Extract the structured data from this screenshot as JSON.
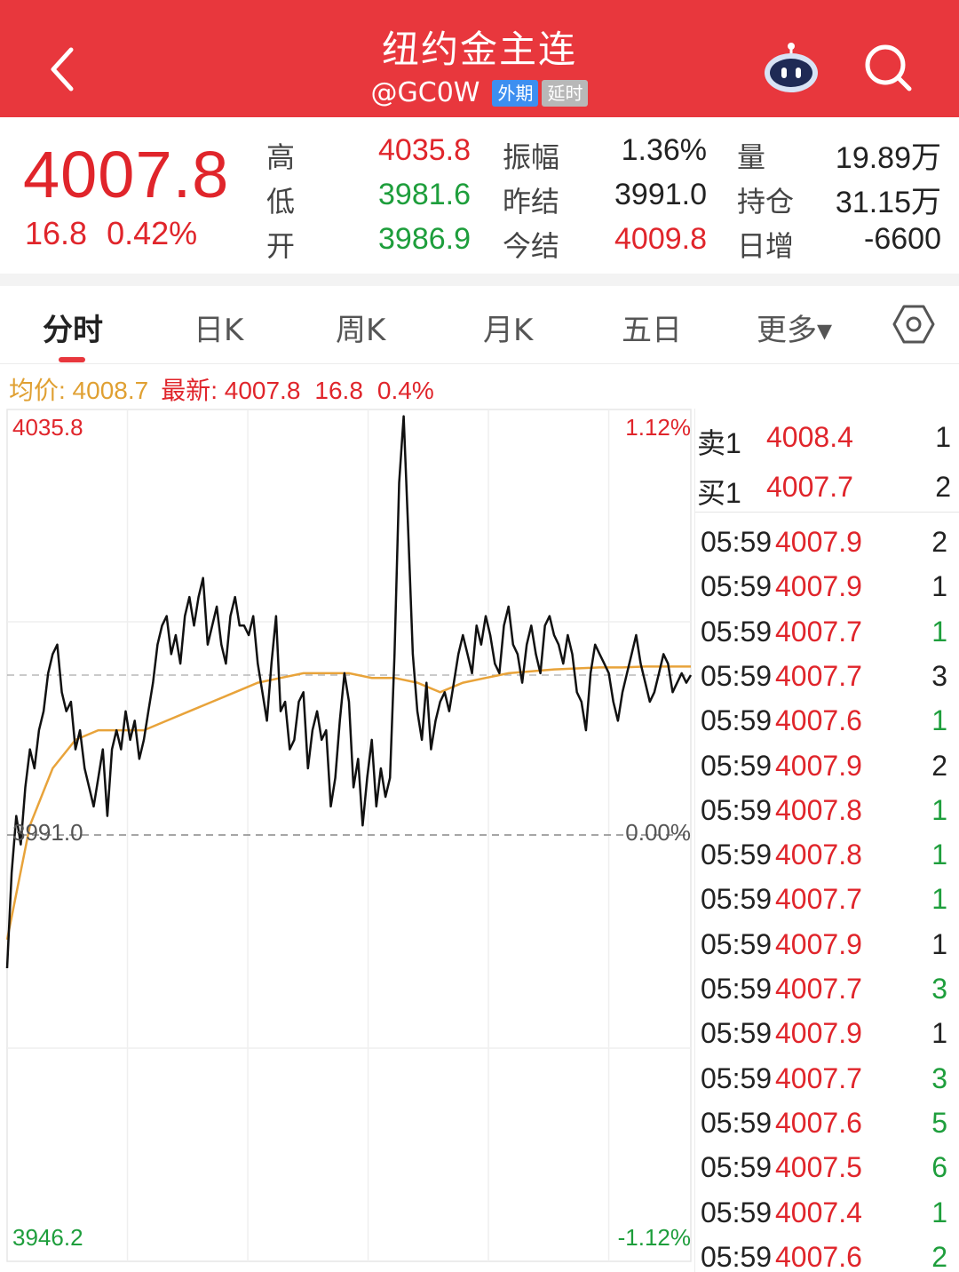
{
  "header": {
    "title": "纽约金主连",
    "code": "@GC0W",
    "tag_foreign": "外期",
    "tag_delay": "延时",
    "bg_color": "#e8373d"
  },
  "quote": {
    "price": "4007.8",
    "change": "16.8",
    "change_pct": "0.42%",
    "fields": [
      {
        "label": "高",
        "value": "4035.8",
        "color": "red"
      },
      {
        "label": "低",
        "value": "3981.6",
        "color": "green"
      },
      {
        "label": "开",
        "value": "3986.9",
        "color": "green"
      },
      {
        "label": "振幅",
        "value": "1.36%",
        "color": "dark"
      },
      {
        "label": "昨结",
        "value": "3991.0",
        "color": "dark"
      },
      {
        "label": "今结",
        "value": "4009.8",
        "color": "red"
      },
      {
        "label": "量",
        "value": "19.89万",
        "color": "dark"
      },
      {
        "label": "持仓",
        "value": "31.15万",
        "color": "dark"
      },
      {
        "label": "日增",
        "value": "-6600",
        "color": "dark"
      }
    ]
  },
  "tabs": [
    {
      "label": "分时",
      "active": true
    },
    {
      "label": "日K",
      "active": false
    },
    {
      "label": "周K",
      "active": false
    },
    {
      "label": "月K",
      "active": false
    },
    {
      "label": "五日",
      "active": false
    },
    {
      "label": "更多▾",
      "active": false
    }
  ],
  "info": {
    "avg_label": "均价: 4008.7",
    "latest_label": "最新: 4007.8",
    "change": "16.8",
    "change_pct": "0.4%"
  },
  "chart_data": {
    "type": "line",
    "y_top_label": "4035.8",
    "y_mid_label": "3991.0",
    "y_bottom_label": "3946.2",
    "pct_top_label": "1.12%",
    "pct_mid_label": "0.00%",
    "pct_bottom_label": "-1.12%",
    "ylim": [
      3946.2,
      4035.8
    ],
    "reference": 3991.0,
    "last_price": 4007.8,
    "price_color": "#111111",
    "avg_color": "#e8a33a",
    "series": [
      {
        "name": "price",
        "x": [
          0,
          2,
          4,
          6,
          8,
          10,
          12,
          14,
          16,
          18,
          20,
          22,
          24,
          26,
          28,
          30,
          32,
          34,
          36,
          38,
          40,
          42,
          44,
          46,
          48,
          50,
          52,
          54,
          56,
          58,
          60,
          62,
          64,
          66,
          68,
          70,
          72,
          74,
          76,
          78,
          80,
          82,
          84,
          86,
          88,
          90,
          92,
          94,
          96,
          98,
          100,
          102,
          104,
          106,
          108,
          110,
          112,
          114,
          116,
          118,
          120,
          122,
          124,
          126,
          128,
          130,
          132,
          134,
          136,
          138,
          140,
          142,
          144,
          146,
          148,
          150,
          152,
          154,
          156,
          158,
          160,
          162,
          164,
          166,
          168,
          170,
          172,
          174,
          176,
          178,
          180,
          182,
          184,
          186,
          188,
          190,
          192,
          194,
          196,
          198,
          200,
          202,
          204,
          206,
          208,
          210,
          212,
          214,
          216,
          218,
          220,
          222,
          224,
          226,
          228,
          230,
          232,
          234,
          236,
          238,
          240,
          242,
          244,
          246,
          248,
          250,
          252,
          254,
          256,
          258,
          260,
          262,
          264,
          266,
          268,
          270,
          272,
          274,
          276,
          278,
          280,
          282,
          284,
          286,
          288,
          290,
          292,
          294,
          296,
          298,
          300
        ],
        "values": [
          3977,
          3987,
          3993,
          3990,
          3996,
          4000,
          3998,
          4002,
          4004,
          4008,
          4010,
          4011,
          4006,
          4004,
          4005,
          4000,
          4002,
          3998,
          3996,
          3994,
          3997,
          4000,
          3993,
          4000,
          4002,
          4000,
          4004,
          4001,
          4003,
          3999,
          4001,
          4004,
          4007,
          4011,
          4013,
          4014,
          4010,
          4012,
          4009,
          4014,
          4016,
          4013,
          4016,
          4018,
          4011,
          4013,
          4015,
          4011,
          4009,
          4014,
          4016,
          4013,
          4013,
          4012,
          4014,
          4009,
          4006,
          4003,
          4009,
          4014,
          4004,
          4005,
          4000,
          4001,
          4005,
          4006,
          3998,
          4002,
          4004,
          4001,
          4002,
          3994,
          3997,
          4003,
          4008,
          4005,
          3996,
          3999,
          3992,
          3997,
          4001,
          3994,
          3998,
          3995,
          3997,
          4010,
          4028,
          4035,
          4023,
          4010,
          4004,
          4001,
          4007,
          4000,
          4003,
          4005,
          4006,
          4004,
          4007,
          4010,
          4012,
          4010,
          4008,
          4013,
          4011,
          4014,
          4012,
          4009,
          4008,
          4013,
          4015,
          4011,
          4010,
          4007,
          4011,
          4013,
          4010,
          4008,
          4013,
          4014,
          4012,
          4011,
          4009,
          4012,
          4010,
          4006,
          4005,
          4002,
          4008,
          4011,
          4010,
          4009,
          4008,
          4005,
          4003,
          4006,
          4008,
          4010,
          4012,
          4009,
          4007,
          4005,
          4006,
          4008,
          4010,
          4009,
          4006,
          4007,
          4008,
          4007,
          4007.8
        ]
      },
      {
        "name": "avg",
        "x": [
          0,
          10,
          20,
          30,
          40,
          50,
          60,
          70,
          80,
          90,
          100,
          110,
          120,
          130,
          140,
          150,
          160,
          170,
          180,
          190,
          200,
          210,
          220,
          230,
          240,
          250,
          260,
          270,
          280,
          290,
          300
        ],
        "values": [
          3980,
          3992,
          3998,
          4001,
          4002,
          4002,
          4002,
          4003,
          4004,
          4005,
          4006,
          4007,
          4007.5,
          4008,
          4008,
          4008,
          4007.5,
          4007.5,
          4007,
          4006,
          4007,
          4007.5,
          4008,
          4008.2,
          4008.4,
          4008.5,
          4008.6,
          4008.6,
          4008.7,
          4008.7,
          4008.7
        ]
      }
    ]
  },
  "orderbook": {
    "sell": {
      "label": "卖1",
      "price": "4008.4",
      "qty": "1"
    },
    "buy": {
      "label": "买1",
      "price": "4007.7",
      "qty": "2"
    }
  },
  "ticks": [
    {
      "time": "05:59",
      "price": "4007.9",
      "qty": "2",
      "qty_color": "#222222"
    },
    {
      "time": "05:59",
      "price": "4007.9",
      "qty": "1",
      "qty_color": "#222222"
    },
    {
      "time": "05:59",
      "price": "4007.7",
      "qty": "1",
      "qty_color": "#1e9e3c"
    },
    {
      "time": "05:59",
      "price": "4007.7",
      "qty": "3",
      "qty_color": "#222222"
    },
    {
      "time": "05:59",
      "price": "4007.6",
      "qty": "1",
      "qty_color": "#1e9e3c"
    },
    {
      "time": "05:59",
      "price": "4007.9",
      "qty": "2",
      "qty_color": "#222222"
    },
    {
      "time": "05:59",
      "price": "4007.8",
      "qty": "1",
      "qty_color": "#1e9e3c"
    },
    {
      "time": "05:59",
      "price": "4007.8",
      "qty": "1",
      "qty_color": "#1e9e3c"
    },
    {
      "time": "05:59",
      "price": "4007.7",
      "qty": "1",
      "qty_color": "#1e9e3c"
    },
    {
      "time": "05:59",
      "price": "4007.9",
      "qty": "1",
      "qty_color": "#222222"
    },
    {
      "time": "05:59",
      "price": "4007.7",
      "qty": "3",
      "qty_color": "#1e9e3c"
    },
    {
      "time": "05:59",
      "price": "4007.9",
      "qty": "1",
      "qty_color": "#222222"
    },
    {
      "time": "05:59",
      "price": "4007.7",
      "qty": "3",
      "qty_color": "#1e9e3c"
    },
    {
      "time": "05:59",
      "price": "4007.6",
      "qty": "5",
      "qty_color": "#1e9e3c"
    },
    {
      "time": "05:59",
      "price": "4007.5",
      "qty": "6",
      "qty_color": "#1e9e3c"
    },
    {
      "time": "05:59",
      "price": "4007.4",
      "qty": "1",
      "qty_color": "#1e9e3c"
    },
    {
      "time": "05:59",
      "price": "4007.6",
      "qty": "2",
      "qty_color": "#1e9e3c"
    }
  ]
}
